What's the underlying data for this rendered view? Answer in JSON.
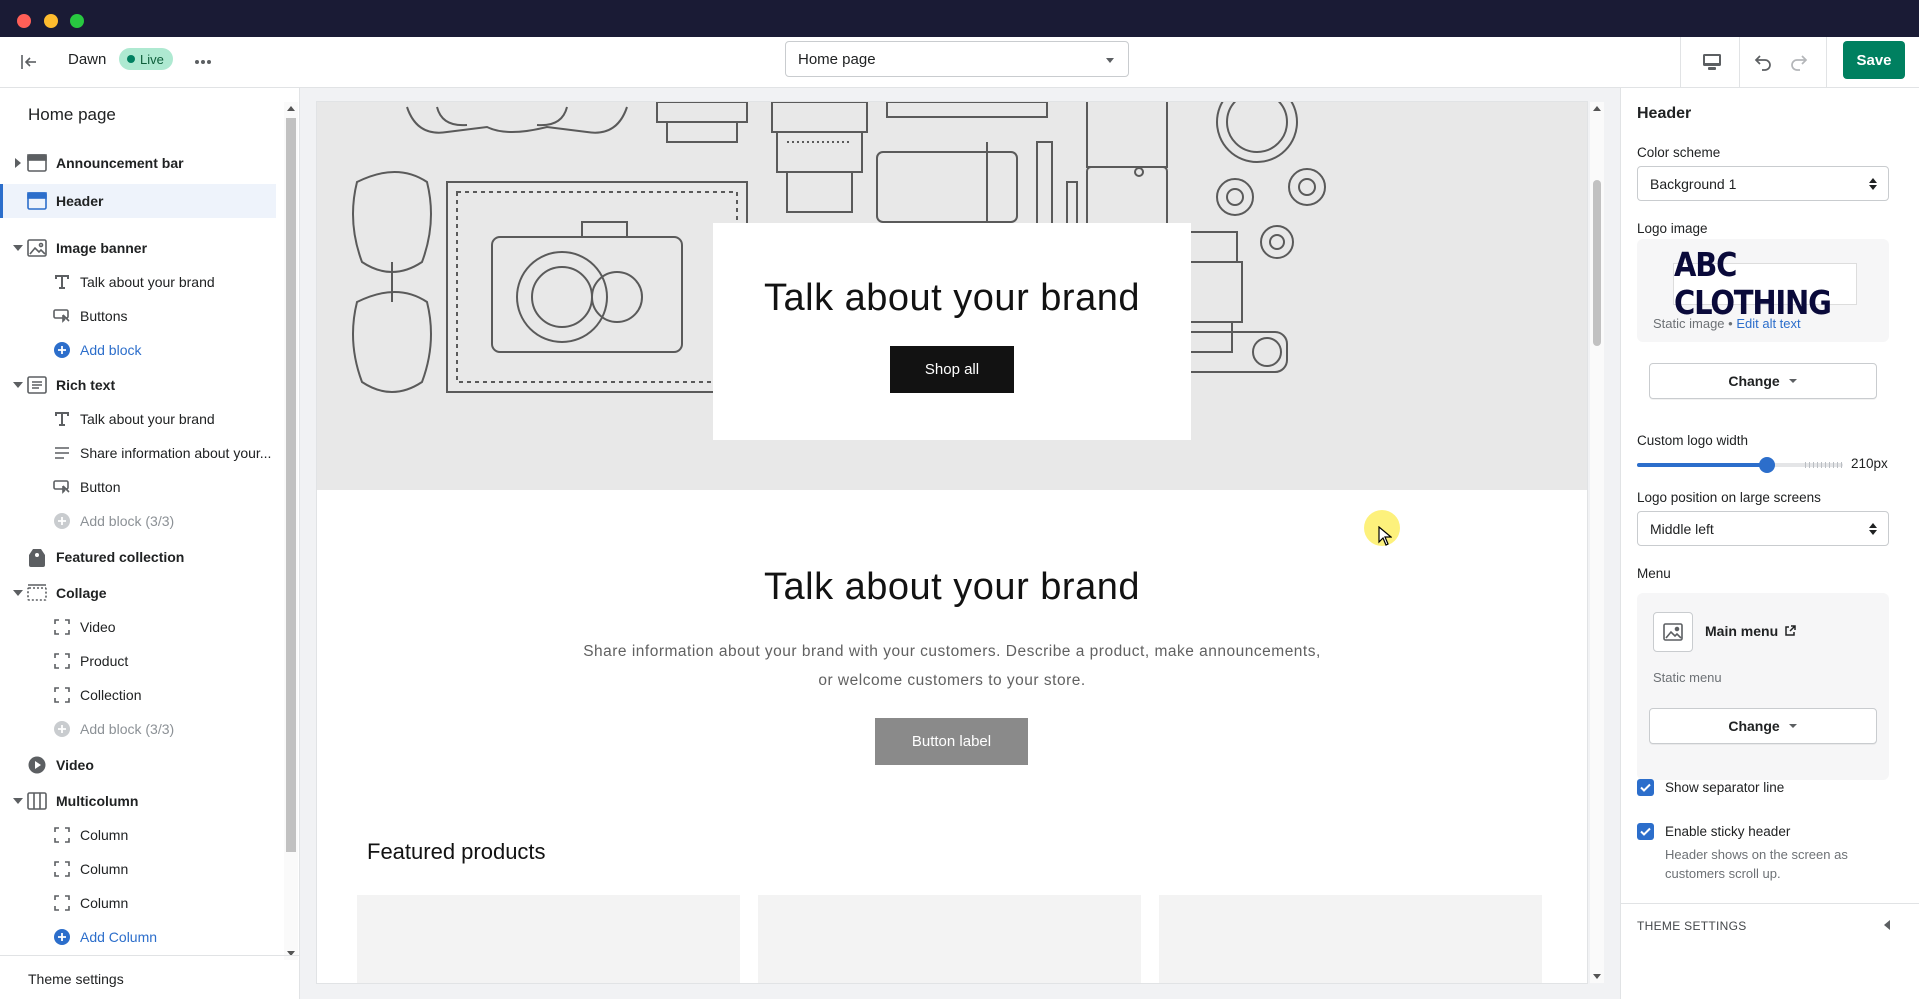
{
  "toolbar": {
    "theme_name": "Dawn",
    "live_label": "Live",
    "page_select_value": "Home page",
    "save_label": "Save"
  },
  "left_panel": {
    "title": "Home page",
    "items": [
      {
        "label": "Announcement bar",
        "type": "section",
        "icon": "announcement-icon"
      },
      {
        "label": "Header",
        "type": "section",
        "icon": "header-icon",
        "selected": true
      },
      {
        "label": "Image banner",
        "type": "section",
        "icon": "image-icon"
      },
      {
        "label": "Talk about your brand",
        "type": "block",
        "icon": "text-icon"
      },
      {
        "label": "Buttons",
        "type": "block",
        "icon": "button-icon"
      },
      {
        "label": "Add block",
        "type": "add",
        "icon": "plus-circle-icon"
      },
      {
        "label": "Rich text",
        "type": "section",
        "icon": "rich-text-icon"
      },
      {
        "label": "Talk about your brand",
        "type": "block",
        "icon": "text-icon"
      },
      {
        "label": "Share information about your...",
        "type": "block",
        "icon": "paragraph-icon"
      },
      {
        "label": "Button",
        "type": "block",
        "icon": "button-icon"
      },
      {
        "label": "Add block (3/3)",
        "type": "add-disabled",
        "icon": "plus-circle-icon"
      },
      {
        "label": "Featured collection",
        "type": "section",
        "icon": "collection-icon"
      },
      {
        "label": "Collage",
        "type": "section",
        "icon": "collage-icon"
      },
      {
        "label": "Video",
        "type": "block",
        "icon": "frame-icon"
      },
      {
        "label": "Product",
        "type": "block",
        "icon": "frame-icon"
      },
      {
        "label": "Collection",
        "type": "block",
        "icon": "frame-icon"
      },
      {
        "label": "Add block (3/3)",
        "type": "add-disabled",
        "icon": "plus-circle-icon"
      },
      {
        "label": "Video",
        "type": "section",
        "icon": "video-icon"
      },
      {
        "label": "Multicolumn",
        "type": "section",
        "icon": "multicolumn-icon"
      },
      {
        "label": "Column",
        "type": "block",
        "icon": "frame-icon"
      },
      {
        "label": "Column",
        "type": "block",
        "icon": "frame-icon"
      },
      {
        "label": "Column",
        "type": "block",
        "icon": "frame-icon"
      },
      {
        "label": "Add Column",
        "type": "add",
        "icon": "plus-circle-icon"
      }
    ],
    "theme_settings_label": "Theme settings"
  },
  "preview": {
    "banner_heading": "Talk about your brand",
    "banner_button": "Shop all",
    "rich_heading": "Talk about your brand",
    "rich_text": "Share information about your brand with your customers. Describe a product, make announcements, or welcome customers to your store.",
    "rich_button": "Button label",
    "featured_title": "Featured products"
  },
  "right_panel": {
    "title": "Header",
    "color_scheme_label": "Color scheme",
    "color_scheme_value": "Background 1",
    "logo_image_label": "Logo image",
    "logo_text": "ABC CLOTHING",
    "static_image": "Static image",
    "bullet": " • ",
    "edit_alt_text": "Edit alt text",
    "change_label": "Change",
    "logo_width_label": "Custom logo width",
    "logo_width_value": "210px",
    "logo_width_fraction": 0.63,
    "logo_position_label": "Logo position on large screens",
    "logo_position_value": "Middle left",
    "menu_label": "Menu",
    "menu_name": "Main menu",
    "menu_static": "Static menu",
    "menu_change_label": "Change",
    "separator_label": "Show separator line",
    "separator_checked": true,
    "sticky_label": "Enable sticky header",
    "sticky_checked": true,
    "sticky_help": "Header shows on the screen as customers scroll up.",
    "theme_settings_head": "THEME SETTINGS"
  },
  "colors": {
    "accent": "#2c6ecb",
    "save": "#008060",
    "titlebar": "#1a1b35",
    "live_badge": "#aee9d1"
  }
}
